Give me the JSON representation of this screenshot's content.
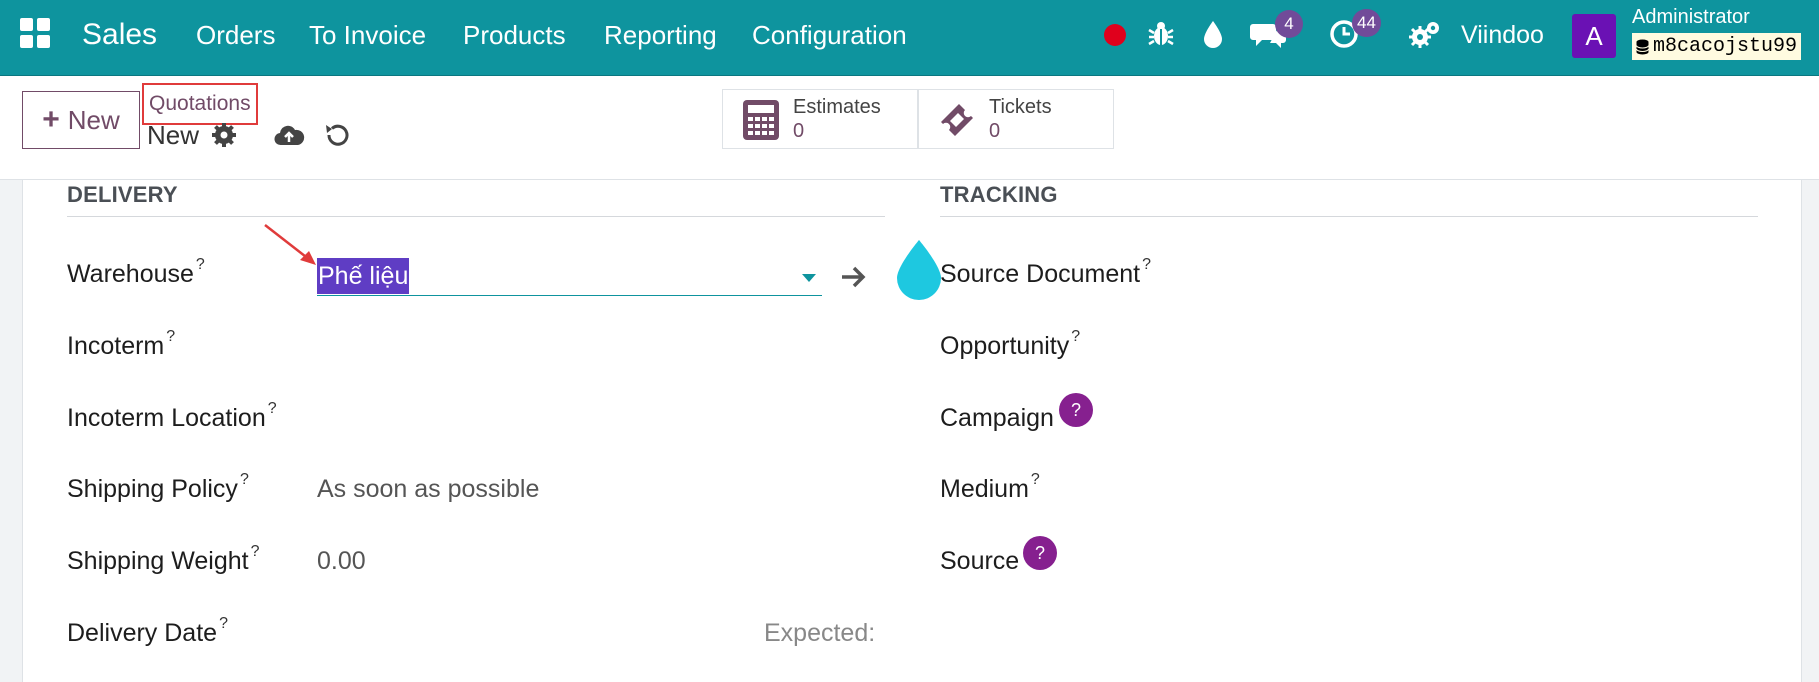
{
  "navbar": {
    "brand": "Sales",
    "menu": [
      "Orders",
      "To Invoice",
      "Products",
      "Reporting",
      "Configuration"
    ],
    "messages_count": "4",
    "activities_count": "44",
    "company": "Viindoo",
    "avatar_letter": "A",
    "user_name": "Administrator",
    "database": "m8cacojstu99"
  },
  "control_panel": {
    "new_label": "New",
    "breadcrumb": "Quotations",
    "record_name": "New",
    "smart_buttons": [
      {
        "label": "Estimates",
        "value": "0",
        "icon": "calculator-icon"
      },
      {
        "label": "Tickets",
        "value": "0",
        "icon": "ticket-icon"
      }
    ]
  },
  "delivery": {
    "title": "DELIVERY",
    "warehouse_label": "Warehouse",
    "warehouse_value": "Phế liệu",
    "incoterm_label": "Incoterm",
    "incoterm_location_label": "Incoterm Location",
    "shipping_policy_label": "Shipping Policy",
    "shipping_policy_value": "As soon as possible",
    "shipping_weight_label": "Shipping Weight",
    "shipping_weight_value": "0.00",
    "delivery_date_label": "Delivery Date",
    "expected_label": "Expected:"
  },
  "tracking": {
    "title": "TRACKING",
    "source_document_label": "Source Document",
    "opportunity_label": "Opportunity",
    "campaign_label": "Campaign",
    "medium_label": "Medium",
    "source_label": "Source"
  },
  "help_mark": "?",
  "colors": {
    "navbar": "#0e949e",
    "primary": "#714b67",
    "badge": "#714b99",
    "help": "#86208f",
    "highlight": "#5f3dc4",
    "annotation": "#e03b3b",
    "droplet": "#1ec8e0"
  }
}
